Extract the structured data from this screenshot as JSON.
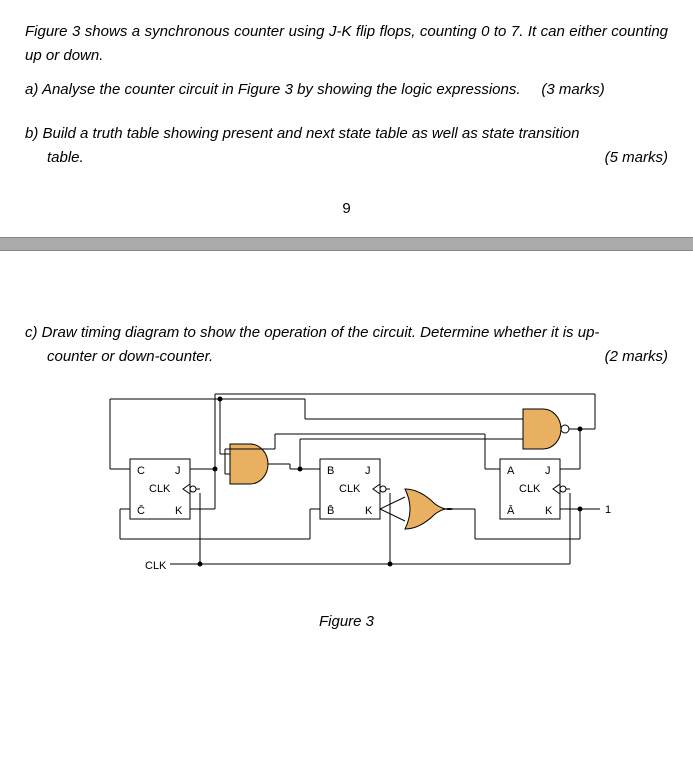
{
  "intro": "Figure 3 shows a synchronous counter using J-K flip flops, counting 0 to 7. It can either counting up or down.",
  "qa": {
    "label": "a)  Analyse the counter circuit in Figure 3 by showing the logic expressions.",
    "marks": "(3 marks)"
  },
  "qb": {
    "label_line1": "b) Build a truth table showing present and next state table as well as state transition",
    "label_line2": "table.",
    "marks": "(5 marks)"
  },
  "page_number": "9",
  "qc": {
    "label_line1": "c) Draw timing diagram to show the operation of the circuit. Determine whether it is up-",
    "label_line2": "counter or down-counter.",
    "marks": "(2 marks)"
  },
  "figure": {
    "caption": "Figure 3",
    "ff_c": {
      "q": "C",
      "qbar": "C̄",
      "j": "J",
      "k": "K",
      "clk": "CLK"
    },
    "ff_b": {
      "q": "B",
      "qbar": "B̄",
      "j": "J",
      "k": "K",
      "clk": "CLK"
    },
    "ff_a": {
      "q": "A",
      "qbar": "Ā",
      "j": "J",
      "k": "K",
      "clk": "CLK"
    },
    "clk_label": "CLK",
    "constant": "1"
  }
}
